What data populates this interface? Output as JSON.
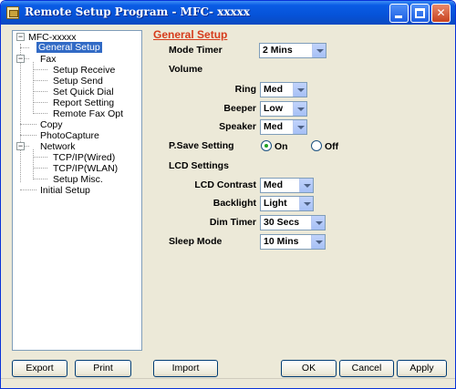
{
  "window": {
    "title": "Remote Setup Program - MFC- xxxxx",
    "controls": {
      "minimize": "",
      "maximize": "",
      "close": "✕"
    }
  },
  "tree": {
    "root": {
      "label": "MFC-xxxxx",
      "toggle": "−"
    },
    "items": [
      {
        "label": "General Setup",
        "selected": true
      },
      {
        "label": "Fax",
        "toggle": "−"
      },
      {
        "label": "Setup Receive"
      },
      {
        "label": "Setup Send"
      },
      {
        "label": "Set Quick Dial"
      },
      {
        "label": "Report Setting"
      },
      {
        "label": "Remote Fax Opt"
      },
      {
        "label": "Copy"
      },
      {
        "label": "PhotoCapture"
      },
      {
        "label": "Network",
        "toggle": "−"
      },
      {
        "label": "TCP/IP(Wired)"
      },
      {
        "label": "TCP/IP(WLAN)"
      },
      {
        "label": "Setup Misc."
      },
      {
        "label": "Initial Setup"
      }
    ]
  },
  "general_setup": {
    "title": "General Setup",
    "mode_timer": {
      "label": "Mode Timer",
      "value": "2 Mins"
    },
    "volume": {
      "label": "Volume",
      "ring": {
        "label": "Ring",
        "value": "Med"
      },
      "beeper": {
        "label": "Beeper",
        "value": "Low"
      },
      "speaker": {
        "label": "Speaker",
        "value": "Med"
      }
    },
    "psave": {
      "label": "P.Save Setting",
      "on": "On",
      "off": "Off",
      "selected": "On"
    },
    "lcd": {
      "label": "LCD Settings",
      "contrast": {
        "label": "LCD Contrast",
        "value": "Med"
      },
      "backlight": {
        "label": "Backlight",
        "value": "Light"
      },
      "dim_timer": {
        "label": "Dim Timer",
        "value": "30 Secs"
      }
    },
    "sleep_mode": {
      "label": "Sleep Mode",
      "value": "10 Mins"
    }
  },
  "buttons": {
    "export": "Export",
    "print": "Print",
    "import": "Import",
    "ok": "OK",
    "cancel": "Cancel",
    "apply": "Apply"
  },
  "colors": {
    "title_bar": "#0a5ce5",
    "section_title": "#d63c1c",
    "selection": "#316ac5"
  }
}
